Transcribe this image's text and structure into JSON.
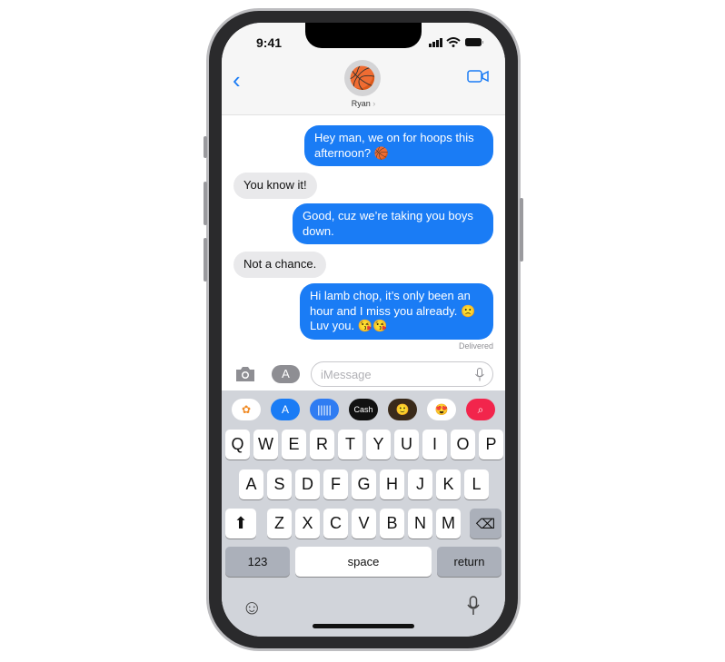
{
  "status": {
    "time": "9:41"
  },
  "header": {
    "contact_name": "Ryan",
    "avatar_emoji": "🏀"
  },
  "messages": [
    {
      "dir": "out",
      "text": "Hey man, we on for hoops this afternoon? 🏀"
    },
    {
      "dir": "in",
      "text": "You know it!"
    },
    {
      "dir": "out",
      "text": "Good, cuz we’re taking you boys down."
    },
    {
      "dir": "in",
      "text": "Not a chance."
    },
    {
      "dir": "out",
      "text": "Hi lamb chop, it’s only been an hour and I miss you already. 🙁 Luv you. 😘😘"
    }
  ],
  "delivered": "Delivered",
  "input": {
    "placeholder": "iMessage"
  },
  "apps": [
    {
      "name": "photos",
      "label": "✿"
    },
    {
      "name": "app-store",
      "label": "A"
    },
    {
      "name": "audio",
      "label": "|||||"
    },
    {
      "name": "apple-cash",
      "label": "Cash"
    },
    {
      "name": "memoji",
      "label": "🙂"
    },
    {
      "name": "memoji-stickers",
      "label": "😍"
    },
    {
      "name": "search-images",
      "label": "⌕"
    }
  ],
  "keyboard": {
    "row1": [
      "Q",
      "W",
      "E",
      "R",
      "T",
      "Y",
      "U",
      "I",
      "O",
      "P"
    ],
    "row2": [
      "A",
      "S",
      "D",
      "F",
      "G",
      "H",
      "J",
      "K",
      "L"
    ],
    "row3": [
      "Z",
      "X",
      "C",
      "V",
      "B",
      "N",
      "M"
    ],
    "numbers": "123",
    "space": "space",
    "return": "return"
  },
  "colors": {
    "accent": "#1a7cf5",
    "incoming": "#e9e9eb",
    "keyboard": "#d1d4da"
  }
}
